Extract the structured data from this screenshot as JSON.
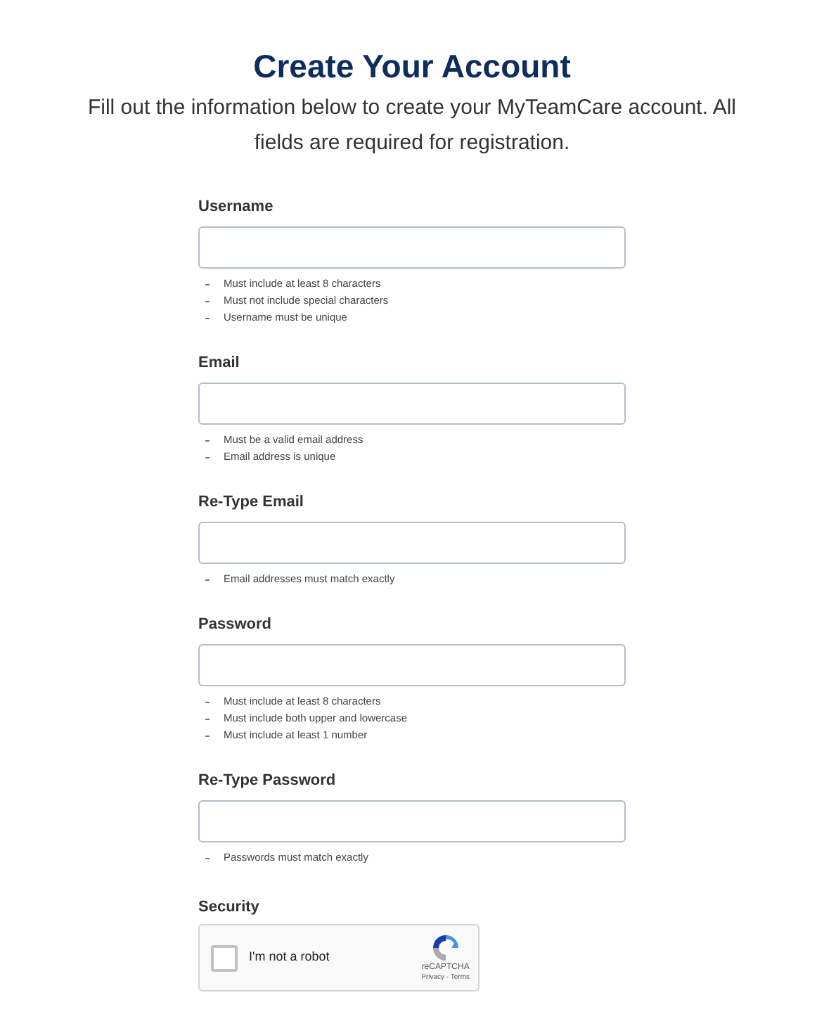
{
  "title": "Create Your Account",
  "intro": "Fill out the information below to create your MyTeamCare account. All fields are required for registration.",
  "fields": [
    {
      "label": "Username",
      "hints": [
        "Must include at least 8 characters",
        "Must not include special characters",
        "Username must be unique"
      ]
    },
    {
      "label": "Email",
      "hints": [
        "Must be a valid email address",
        "Email address is unique"
      ]
    },
    {
      "label": "Re-Type Email",
      "hints": [
        "Email addresses must match exactly"
      ]
    },
    {
      "label": "Password",
      "hints": [
        "Must include at least 8 characters",
        "Must include both upper and lowercase",
        "Must include at least 1 number"
      ]
    },
    {
      "label": "Re-Type Password",
      "hints": [
        "Passwords must match exactly"
      ]
    }
  ],
  "security": {
    "label": "Security",
    "captcha": {
      "checked": false,
      "text": "I'm not a robot",
      "brand": "reCAPTCHA",
      "links": "Privacy - Terms"
    }
  }
}
